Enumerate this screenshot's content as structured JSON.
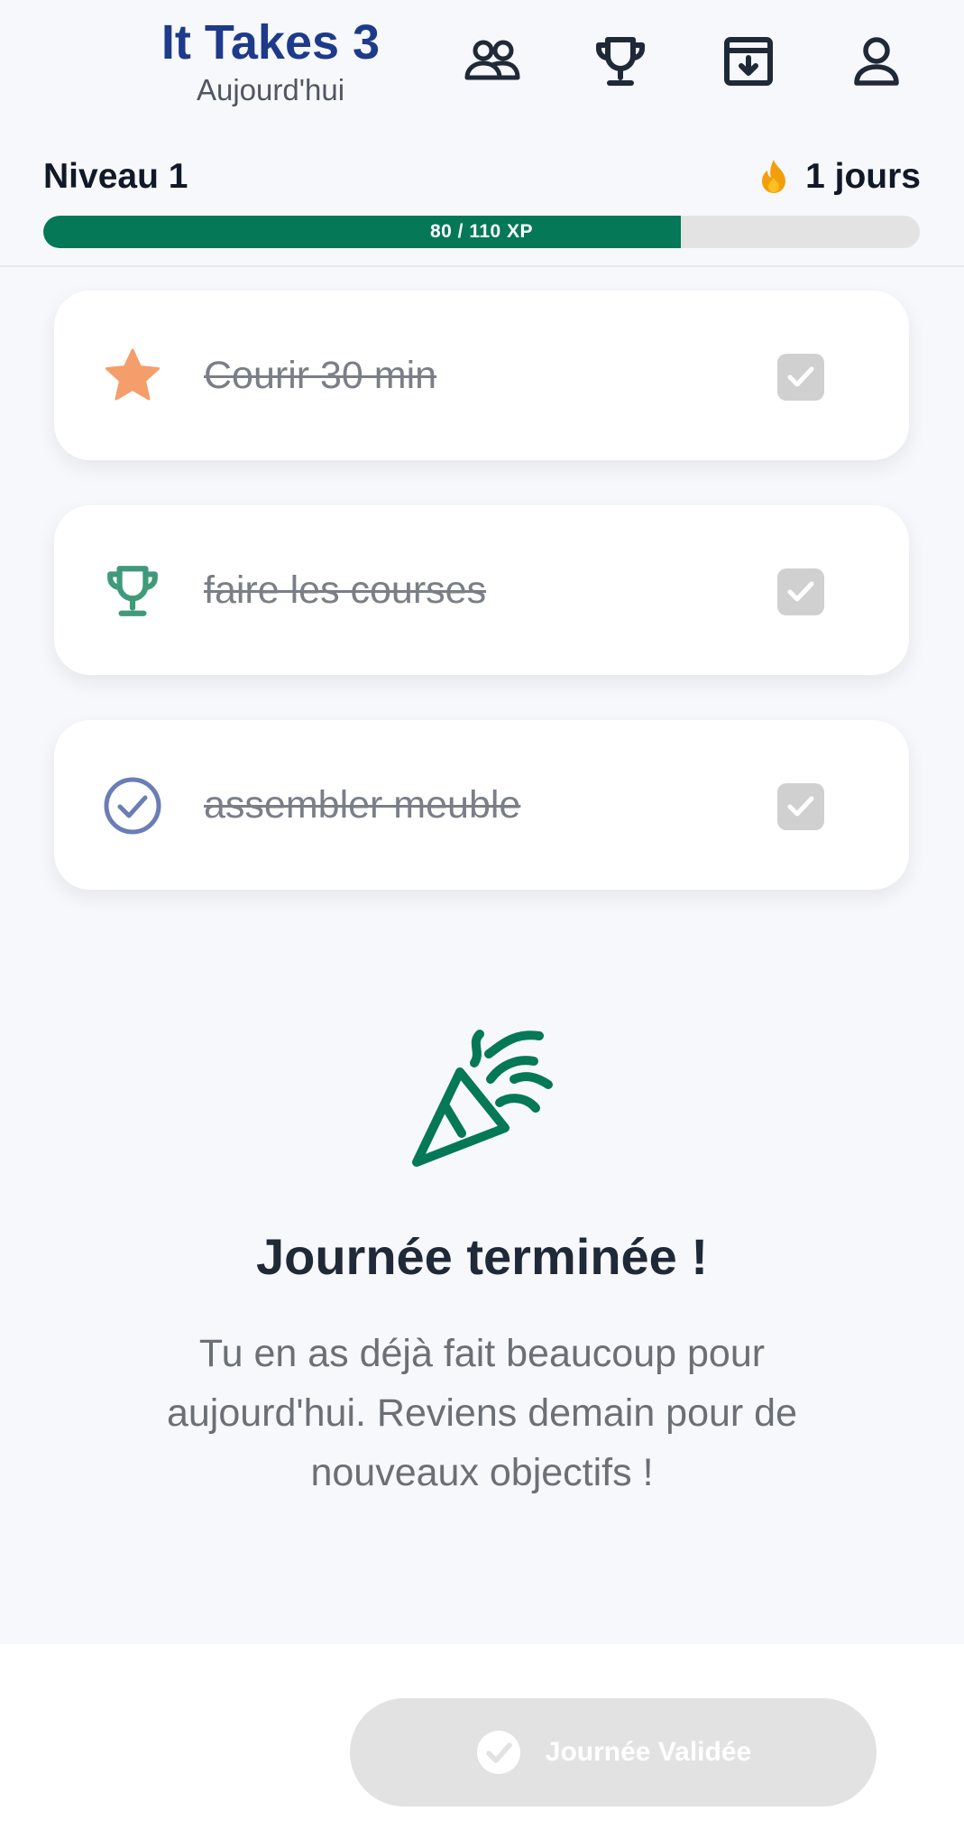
{
  "header": {
    "title": "It Takes 3",
    "subtitle": "Aujourd'hui",
    "nav": [
      "group-icon",
      "trophy-icon",
      "archive-icon",
      "profile-icon"
    ]
  },
  "progress": {
    "level_label": "Niveau 1",
    "streak_text": "1 jours",
    "xp_current": 80,
    "xp_max": 110,
    "xp_text": "80 / 110 XP",
    "fill_color": "#047857"
  },
  "tasks": [
    {
      "label": "Courir 30 min",
      "icon": "star-icon",
      "icon_color": "#f59e6b",
      "checked": true
    },
    {
      "label": "faire les courses",
      "icon": "trophy-icon",
      "icon_color": "#3f9a7a",
      "checked": true
    },
    {
      "label": "assembler meuble",
      "icon": "check-circle-icon",
      "icon_color": "#6b7db5",
      "checked": true
    }
  ],
  "completion": {
    "icon": "party-popper-icon",
    "title": "Journée terminée !",
    "message": "Tu en as déjà fait beaucoup pour aujourd'hui. Reviens demain pour de nouveaux objectifs !"
  },
  "footer": {
    "button_label": "Journée Validée",
    "button_icon": "check-circle-icon"
  },
  "colors": {
    "brand": "#1e3a8a",
    "accent": "#047857",
    "streak": "#f59e0b"
  }
}
